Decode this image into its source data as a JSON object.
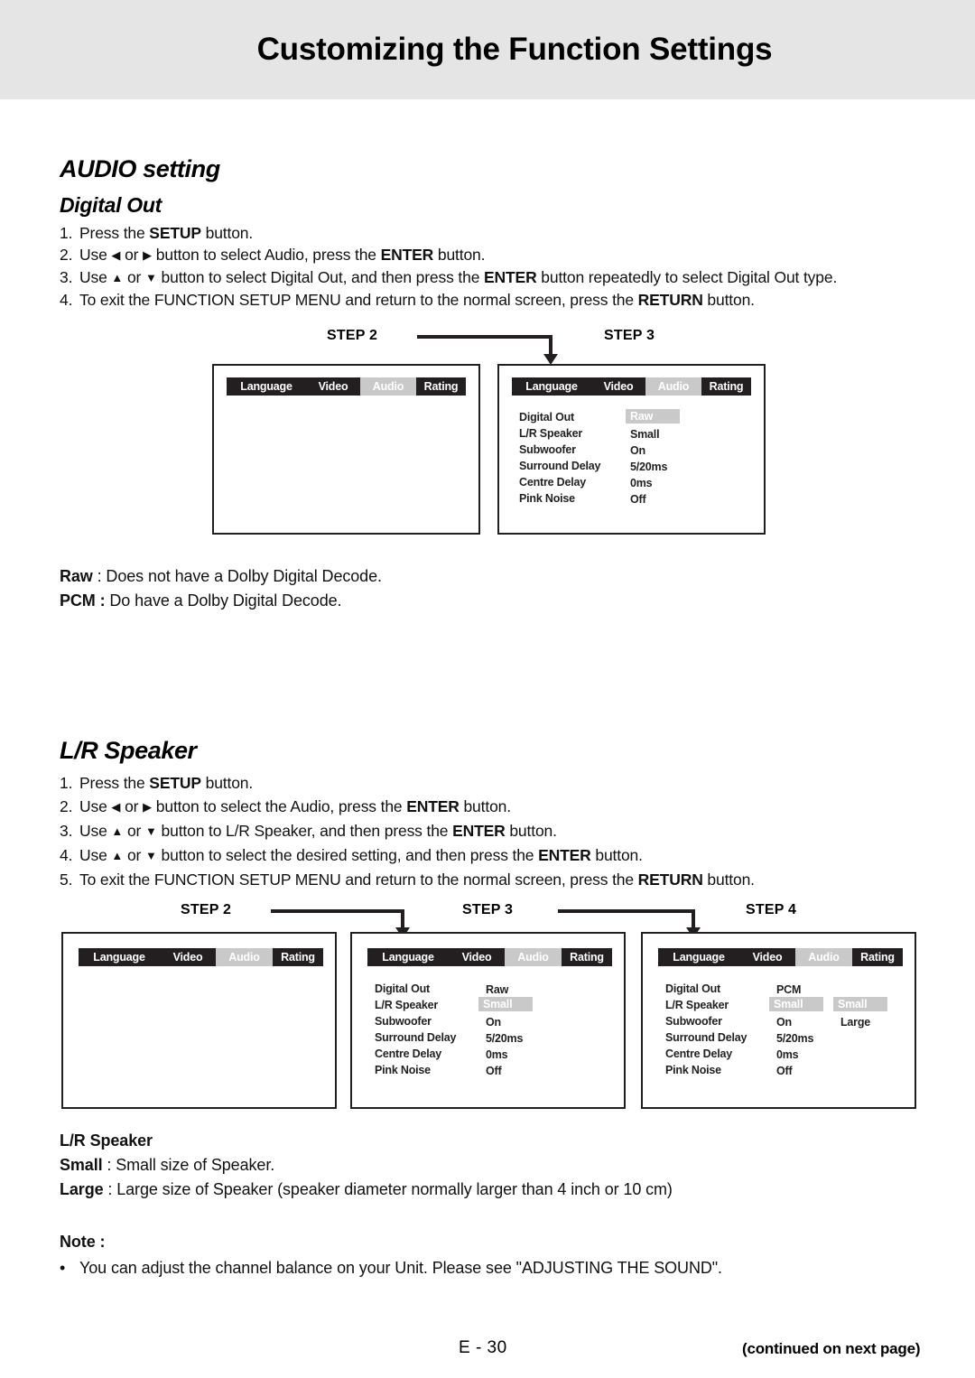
{
  "header": {
    "title": "Customizing the Function Settings"
  },
  "audio_section": {
    "heading": "AUDIO setting",
    "digital_out": {
      "heading": "Digital Out",
      "steps": [
        {
          "num": "1.",
          "pre": "Press the ",
          "bold1": "SETUP",
          "mid": " button.",
          "bold2": "",
          "post": ""
        },
        {
          "num": "2.",
          "pre": "Use ",
          "arrow_left": "◀",
          "or": " or ",
          "arrow_right": "▶",
          "text": " button to select Audio, press the ",
          "bold": "ENTER",
          "tail": " button."
        },
        {
          "num": "3.",
          "pre": "Use ",
          "arrow_up": "▲",
          "or": " or ",
          "arrow_down": "▼",
          "text": " button to select Digital Out, and then press the ",
          "bold": "ENTER",
          "tail": " button repeatedly to select Digital Out type."
        },
        {
          "num": "4.",
          "pre": "To exit the FUNCTION SETUP MENU and return to the normal screen, press the ",
          "bold": "RETURN",
          "tail": " button."
        }
      ],
      "definitions": [
        {
          "term": "Raw",
          "sep": " : ",
          "desc": "Does not have a Dolby Digital Decode."
        },
        {
          "term": "PCM :",
          "sep": " ",
          "desc": "Do have a Dolby Digital Decode."
        }
      ]
    },
    "lr_speaker": {
      "heading": "L/R Speaker",
      "steps": [
        {
          "num": "1.",
          "pre": "Press the ",
          "bold": "SETUP",
          "tail": " button."
        },
        {
          "num": "2.",
          "pre": "Use ",
          "arrow_left": "◀",
          "or": " or ",
          "arrow_right": "▶",
          "text": " button to select the Audio, press the ",
          "bold": "ENTER",
          "tail": " button."
        },
        {
          "num": "3.",
          "pre": "Use ",
          "arrow_up": "▲",
          "or": " or ",
          "arrow_down": "▼",
          "text": " button to L/R Speaker, and then press the ",
          "bold": "ENTER",
          "tail": " button."
        },
        {
          "num": "4.",
          "pre": "Use ",
          "arrow_up": "▲",
          "or": " or ",
          "arrow_down": "▼",
          "text": " button to select the desired setting, and then press the ",
          "bold": "ENTER",
          "tail": " button."
        },
        {
          "num": "5.",
          "pre": "To exit the FUNCTION SETUP MENU and return to the normal screen, press the ",
          "bold": "RETURN",
          "tail": " button."
        }
      ],
      "definitions_heading": "L/R Speaker",
      "definitions": [
        {
          "term": "Small",
          "sep": " : ",
          "desc": "Small size of Speaker."
        },
        {
          "term": "Large",
          "sep": " : ",
          "desc": "Large size of Speaker (speaker diameter normally larger than 4 inch or 10 cm)"
        }
      ]
    }
  },
  "note": {
    "heading": "Note :",
    "bullet": "•",
    "text": "You can adjust the channel balance on your Unit. Please see \"ADJUSTING THE SOUND\"."
  },
  "osd": {
    "tabs": [
      "Language",
      "Video",
      "Audio",
      "Rating"
    ],
    "active_tab": "Audio",
    "labels": [
      "Digital Out",
      "L/R Speaker",
      "Subwoofer",
      "Surround Delay",
      "Centre Delay",
      "Pink Noise"
    ]
  },
  "diagram_digital_out": {
    "step_labels": [
      "STEP  2",
      "STEP  3"
    ],
    "screens": [
      {
        "step": "STEP  2",
        "rows": []
      },
      {
        "step": "STEP  3",
        "rows": [
          {
            "label": "Digital Out",
            "value": "Raw",
            "highlight": true
          },
          {
            "label": "L/R Speaker",
            "value": "Small",
            "highlight": false
          },
          {
            "label": "Subwoofer",
            "value": "On",
            "highlight": false
          },
          {
            "label": "Surround Delay",
            "value": "5/20ms",
            "highlight": false
          },
          {
            "label": "Centre Delay",
            "value": "0ms",
            "highlight": false
          },
          {
            "label": "Pink Noise",
            "value": "Off",
            "highlight": false
          }
        ]
      }
    ]
  },
  "diagram_lr_speaker": {
    "step_labels": [
      "STEP  2",
      "STEP  3",
      "STEP  4"
    ],
    "screens": [
      {
        "step": "STEP  2",
        "rows": []
      },
      {
        "step": "STEP  3",
        "rows": [
          {
            "label": "Digital Out",
            "value": "Raw",
            "highlight": false
          },
          {
            "label": "L/R Speaker",
            "value": "Small",
            "highlight": true
          },
          {
            "label": "Subwoofer",
            "value": "On",
            "highlight": false
          },
          {
            "label": "Surround Delay",
            "value": "5/20ms",
            "highlight": false
          },
          {
            "label": "Centre Delay",
            "value": "0ms",
            "highlight": false
          },
          {
            "label": "Pink Noise",
            "value": "Off",
            "highlight": false
          }
        ]
      },
      {
        "step": "STEP  4",
        "rows": [
          {
            "label": "Digital Out",
            "value": "PCM",
            "highlight": false,
            "value2": "",
            "highlight2": false
          },
          {
            "label": "L/R Speaker",
            "value": "Small",
            "highlight": true,
            "value2": "Small",
            "highlight2": true
          },
          {
            "label": "Subwoofer",
            "value": "On",
            "highlight": false,
            "value2": "Large",
            "highlight2": false
          },
          {
            "label": "Surround Delay",
            "value": "5/20ms",
            "highlight": false,
            "value2": "",
            "highlight2": false
          },
          {
            "label": "Centre Delay",
            "value": "0ms",
            "highlight": false,
            "value2": "",
            "highlight2": false
          },
          {
            "label": "Pink Noise",
            "value": "Off",
            "highlight": false,
            "value2": "",
            "highlight2": false
          }
        ]
      }
    ]
  },
  "footer": {
    "page_number": "E - 30",
    "continued": "(continued on next page)"
  },
  "colors": {
    "header_band": "#e5e5e5",
    "menubar_bg": "#231f20",
    "highlight_bg": "#c9c9c9",
    "text": "#111111"
  }
}
